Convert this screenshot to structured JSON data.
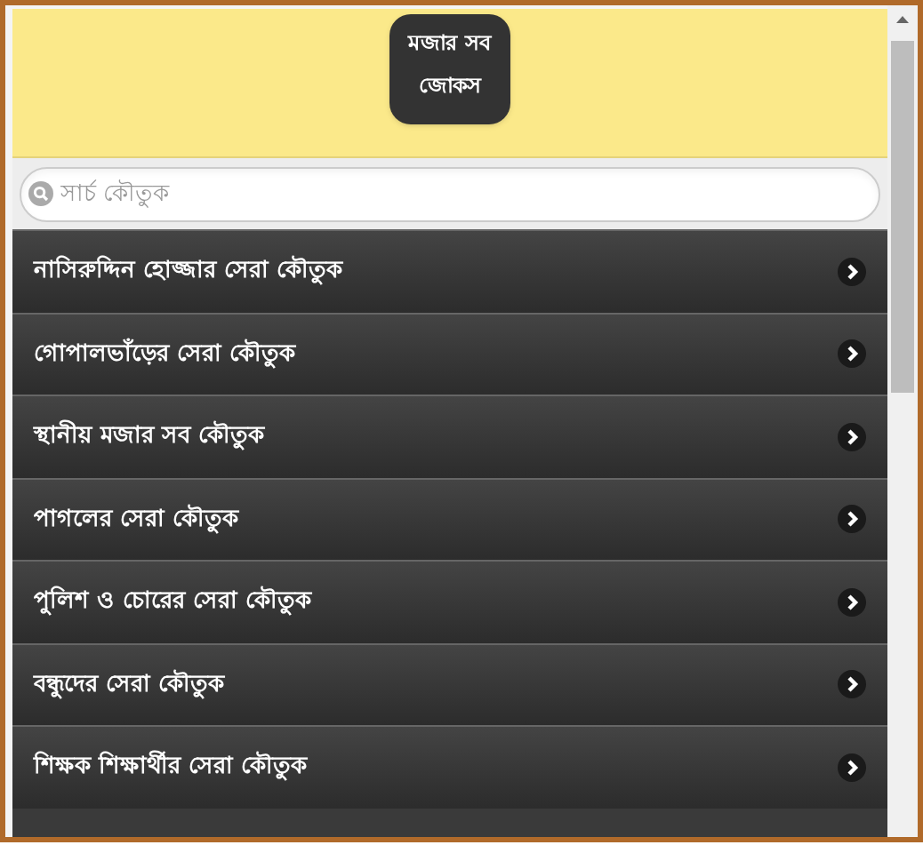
{
  "header": {
    "title": "মজার সব জোকস"
  },
  "search": {
    "placeholder": "সার্চ কৌতুক"
  },
  "list": [
    {
      "label": "নাসিরুদ্দিন হোজ্জার সেরা কৌতুক"
    },
    {
      "label": "গোপালভাঁড়ের সেরা কৌতুক"
    },
    {
      "label": "স্থানীয় মজার সব কৌতুক"
    },
    {
      "label": "পাগলের সেরা কৌতুক"
    },
    {
      "label": "পুলিশ ও চোরের সেরা কৌতুক"
    },
    {
      "label": "বন্ধুদের সেরা কৌতুক"
    },
    {
      "label": "শিক্ষক শিক্ষার্থীর সেরা কৌতুক"
    }
  ]
}
